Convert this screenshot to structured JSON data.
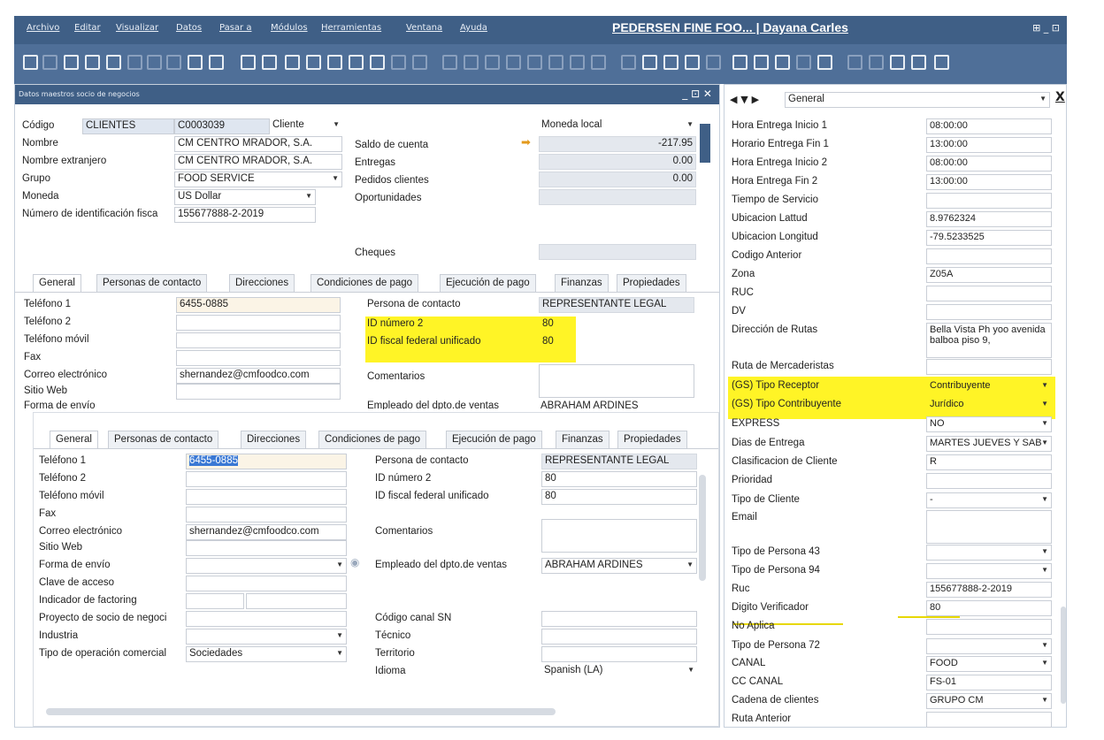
{
  "app": {
    "title": "PEDERSEN FINE FOO... | Dayana Carles",
    "window_controls": "⊞ _ ⊡",
    "menu": [
      "Archivo",
      "Editar",
      "Visualizar",
      "Datos",
      "Pasar a",
      "Módulos",
      "Herramientas",
      "Ventana",
      "Ayuda"
    ]
  },
  "left": {
    "title": "Datos maestros socio de negocios",
    "controls": "_ ⊡ ✕",
    "header": {
      "codigo_label": "Código",
      "codigo_series": "CLIENTES",
      "codigo_value": "C0003039",
      "type_value": "Cliente",
      "nombre_label": "Nombre",
      "nombre_value": "CM CENTRO MRADOR, S.A.",
      "nombre_ext_label": "Nombre extranjero",
      "nombre_ext_value": "CM CENTRO MRADOR, S.A.",
      "grupo_label": "Grupo",
      "grupo_value": "FOOD SERVICE",
      "moneda_label": "Moneda",
      "moneda_value": "US Dollar",
      "nif_label": "Número de identificación fisca",
      "nif_value": "155677888-2-2019",
      "moneda_local": "Moneda local",
      "saldo_label": "Saldo de cuenta",
      "saldo_value": "-217.95",
      "entregas_label": "Entregas",
      "entregas_value": "0.00",
      "pedidos_label": "Pedidos clientes",
      "pedidos_value": "0.00",
      "oport_label": "Oportunidades",
      "cheques_label": "Cheques"
    },
    "tabs": [
      "General",
      "Personas de contacto",
      "Direcciones",
      "Condiciones de pago",
      "Ejecución de pago",
      "Finanzas",
      "Propiedades"
    ],
    "top_panel": {
      "tel1_label": "Teléfono 1",
      "tel1_value": "6455-0885",
      "tel2_label": "Teléfono 2",
      "movil_label": "Teléfono móvil",
      "fax_label": "Fax",
      "correo_label": "Correo electrónico",
      "correo_value": "shernandez@cmfoodco.com",
      "web_label": "Sitio Web",
      "envio_label": "Forma de envío",
      "contacto_label": "Persona de contacto",
      "contacto_value": "REPRESENTANTE LEGAL",
      "idnum2_label": "ID número 2",
      "idnum2_value": "80",
      "idfiscal_label": "ID fiscal federal unificado",
      "idfiscal_value": "80",
      "comentarios_label": "Comentarios",
      "empleado_label": "Empleado del dpto.de ventas",
      "empleado_value": "ABRAHAM ARDINES"
    },
    "bottom_panel": {
      "tel1_label": "Teléfono 1",
      "tel1_value": "6455-0885",
      "tel2_label": "Teléfono 2",
      "movil_label": "Teléfono móvil",
      "fax_label": "Fax",
      "correo_label": "Correo electrónico",
      "correo_value": "shernandez@cmfoodco.com",
      "web_label": "Sitio Web",
      "envio_label": "Forma de envío",
      "clave_label": "Clave de acceso",
      "factoring_label": "Indicador de factoring",
      "proyecto_label": "Proyecto de socio de negoci",
      "industria_label": "Industria",
      "tipo_op_label": "Tipo de operación comercial",
      "tipo_op_value": "Sociedades",
      "contacto_label": "Persona de contacto",
      "contacto_value": "REPRESENTANTE LEGAL",
      "idnum2_label": "ID número 2",
      "idnum2_value": "80",
      "idfiscal_label": "ID fiscal federal unificado",
      "idfiscal_value": "80",
      "comentarios_label": "Comentarios",
      "empleado_label": "Empleado del dpto.de ventas",
      "empleado_value": "ABRAHAM ARDINES",
      "canal_sn_label": "Código canal SN",
      "tecnico_label": "Técnico",
      "territorio_label": "Territorio",
      "idioma_label": "Idioma",
      "idioma_value": "Spanish (LA)"
    }
  },
  "right": {
    "dropdown": "General",
    "close": "X",
    "nav": "◀ ▼ ▶",
    "rows": [
      {
        "label": "Hora Entrega Inicio 1",
        "value": "08:00:00"
      },
      {
        "label": "Horario Entrega Fin 1",
        "value": "13:00:00"
      },
      {
        "label": "Hora Entrega Inicio 2",
        "value": "08:00:00"
      },
      {
        "label": "Hora Entrega Fin 2",
        "value": "13:00:00"
      },
      {
        "label": "Tiempo de Servicio",
        "value": ""
      },
      {
        "label": "Ubicacion Lattud",
        "value": "8.9762324"
      },
      {
        "label": "Ubicacion Longitud",
        "value": "-79.5233525"
      },
      {
        "label": "Codigo Anterior",
        "value": ""
      },
      {
        "label": "Zona",
        "value": "Z05A"
      },
      {
        "label": "RUC",
        "value": ""
      },
      {
        "label": "DV",
        "value": ""
      },
      {
        "label": "Dirección de Rutas",
        "value": "Bella Vista Ph yoo avenida balboa piso 9,"
      },
      {
        "label": "Ruta de Mercaderistas",
        "value": ""
      },
      {
        "label": "(GS) Tipo Receptor",
        "value": "Contribuyente"
      },
      {
        "label": "(GS) Tipo Contribuyente",
        "value": "Jurídico"
      },
      {
        "label": "EXPRESS",
        "value": "NO"
      },
      {
        "label": "Dias de Entrega",
        "value": "MARTES JUEVES Y SAB"
      },
      {
        "label": "Clasificacion de Cliente",
        "value": "R"
      },
      {
        "label": "Prioridad",
        "value": ""
      },
      {
        "label": "Tipo de Cliente",
        "value": "-"
      },
      {
        "label": "Email",
        "value": ""
      },
      {
        "label": "Tipo de Persona 43",
        "value": ""
      },
      {
        "label": "Tipo de Persona 94",
        "value": ""
      },
      {
        "label": "Ruc",
        "value": "155677888-2-2019"
      },
      {
        "label": "Digito Verificador",
        "value": "80"
      },
      {
        "label": "No Aplica",
        "value": ""
      },
      {
        "label": "Tipo de Persona 72",
        "value": ""
      },
      {
        "label": "CANAL",
        "value": "FOOD"
      },
      {
        "label": "CC CANAL",
        "value": "FS-01"
      },
      {
        "label": "Cadena de clientes",
        "value": "GRUPO CM"
      },
      {
        "label": "Ruta Anterior",
        "value": ""
      }
    ]
  },
  "colors": {
    "titlebar": "#3f5f86",
    "toolbar": "#4f6f98",
    "highlight": "#fff200",
    "field_gray": "#e4e8ee"
  }
}
